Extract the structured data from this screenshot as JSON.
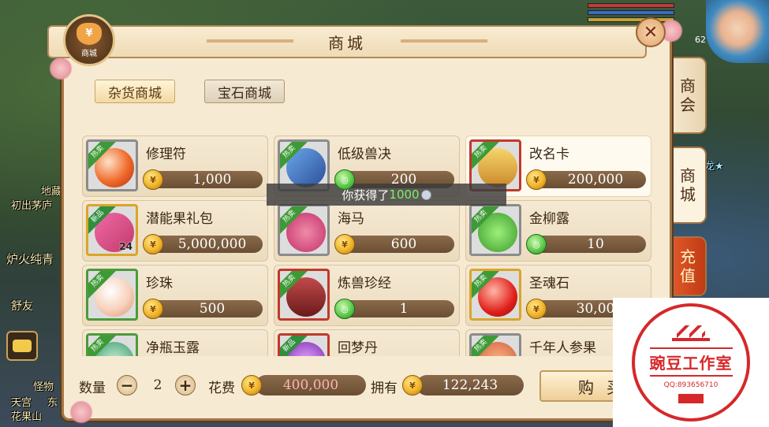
{
  "shop": {
    "title": "商城",
    "emblem_label": "商城",
    "emblem_symbol": "¥",
    "close_symbol": "✕",
    "categories": [
      {
        "label": "杂货商城",
        "active": true
      },
      {
        "label": "宝石商城",
        "active": false
      }
    ],
    "side_tabs": [
      {
        "label": "商\n会"
      },
      {
        "label": "商\n城"
      },
      {
        "label": "充\n值"
      }
    ],
    "items": [
      {
        "name": "修理符",
        "price": "1,000",
        "currency": "gold",
        "tag": "热卖",
        "frame": "gray"
      },
      {
        "name": "低级兽决",
        "price": "200",
        "currency": "jade",
        "tag": "热卖",
        "frame": "gray"
      },
      {
        "name": "改名卡",
        "price": "200,000",
        "currency": "gold",
        "tag": "热卖",
        "frame": "red"
      },
      {
        "name": "潜能果礼包",
        "price": "5,000,000",
        "currency": "gold",
        "tag": "新品",
        "frame": "gold",
        "count": "24"
      },
      {
        "name": "海马",
        "price": "600",
        "currency": "gold",
        "tag": "热卖",
        "frame": "gray"
      },
      {
        "name": "金柳露",
        "price": "10",
        "currency": "jade",
        "tag": "热卖",
        "frame": "gray"
      },
      {
        "name": "珍珠",
        "price": "500",
        "currency": "gold",
        "tag": "热卖",
        "frame": "green"
      },
      {
        "name": "炼兽珍经",
        "price": "1",
        "currency": "jade",
        "tag": "热卖",
        "frame": "red"
      },
      {
        "name": "圣魂石",
        "price": "30,00",
        "currency": "gold",
        "tag": "热卖",
        "frame": "gold"
      },
      {
        "name": "净瓶玉露",
        "price": "",
        "currency": "gold",
        "tag": "热卖",
        "frame": "green"
      },
      {
        "name": "回梦丹",
        "price": "",
        "currency": "gold",
        "tag": "新品",
        "frame": "red"
      },
      {
        "name": "千年人参果",
        "price": "",
        "currency": "gold",
        "tag": "热卖",
        "frame": "gray"
      }
    ],
    "toast": {
      "prefix": "你获得了",
      "amount": "1000"
    },
    "bottom": {
      "qty_label": "数量",
      "qty_value": "2",
      "minus": "−",
      "plus": "+",
      "cost_label": "花费",
      "cost_value": "400,000",
      "own_label": "拥有",
      "own_value": "122,243",
      "buy_label": "购买"
    }
  },
  "background": {
    "texts": [
      "地藏",
      "初出茅庐",
      "炉火纯青",
      "舒友",
      "天宫",
      "东",
      "花果山",
      "怪物",
      "62"
    ],
    "right_tag": "龙★"
  },
  "watermark": {
    "name": "豌豆工作室",
    "qq": "QQ:893656710"
  },
  "colors": {
    "panel_bg": "#f7ead3",
    "panel_border": "#a47544",
    "price_bar": "#6a4e33",
    "hot_ribbon": "#3e9a36",
    "recharge_tab": "#c03a14",
    "watermark_red": "#d6282a"
  }
}
